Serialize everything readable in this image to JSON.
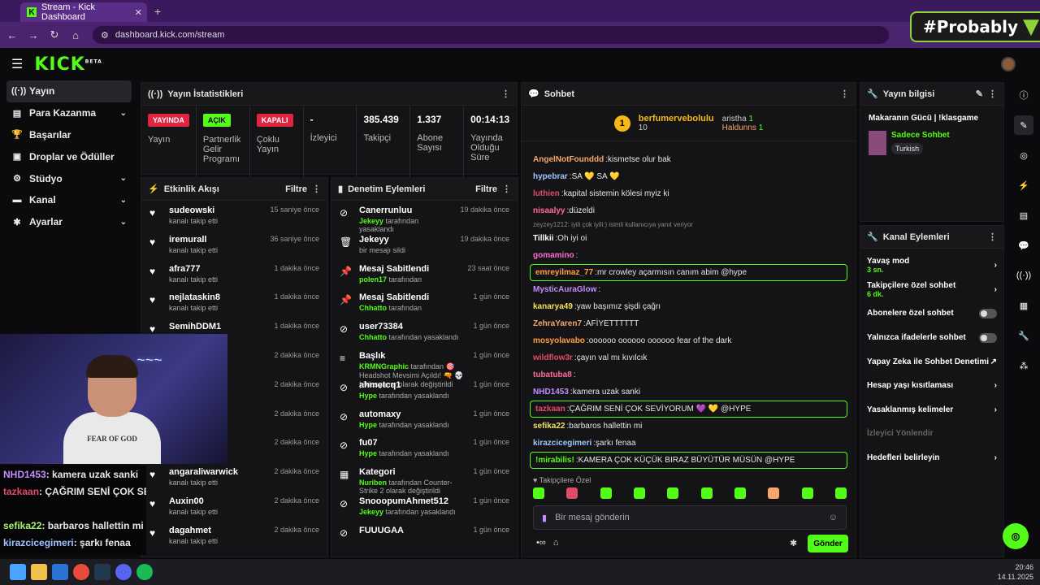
{
  "browser": {
    "tab_title": "Stream - Kick Dashboard",
    "url": "dashboard.kick.com/stream",
    "overlay_brand": "#Probably"
  },
  "colors": {
    "accent": "#53fc18",
    "live": "#e0243f"
  },
  "logo": "KICK",
  "logo_beta": "BETA",
  "sidebar": {
    "items": [
      {
        "label": "Yayın",
        "icon": "broadcast-icon",
        "active": true
      },
      {
        "label": "Para Kazanma",
        "icon": "money-icon",
        "expandable": true
      },
      {
        "label": "Başarılar",
        "icon": "trophy-icon"
      },
      {
        "label": "Droplar ve Ödüller",
        "icon": "gift-icon"
      },
      {
        "label": "Stüdyo",
        "icon": "studio-icon",
        "expandable": true
      },
      {
        "label": "Kanal",
        "icon": "channel-icon",
        "expandable": true
      },
      {
        "label": "Ayarlar",
        "icon": "gear-icon",
        "expandable": true
      }
    ]
  },
  "stats": {
    "title": "Yayın İstatistikleri",
    "cols": [
      {
        "badge": "YAYINDA",
        "label": "Yayın"
      },
      {
        "badge": "AÇIK",
        "label": "Partnerlik Gelir Programı"
      },
      {
        "badge": "KAPALI",
        "label": "Çoklu Yayın"
      },
      {
        "value": "-",
        "label": "İzleyici"
      },
      {
        "value": "385.439",
        "label": "Takipçi"
      },
      {
        "value": "1.337",
        "label": "Abone Sayısı"
      },
      {
        "value": "00:14:13",
        "label": "Yayında Olduğu Süre"
      }
    ]
  },
  "activity": {
    "title": "Etkinlik Akışı",
    "filter": "Filtre",
    "items": [
      {
        "name": "sudeowski",
        "sub": "kanalı takip etti",
        "time": "15 saniye önce"
      },
      {
        "name": "iremurall",
        "sub": "kanalı takip etti",
        "time": "36 saniye önce"
      },
      {
        "name": "afra777",
        "sub": "kanalı takip etti",
        "time": "1 dakika önce"
      },
      {
        "name": "nejlataskin8",
        "sub": "kanalı takip etti",
        "time": "1 dakika önce"
      },
      {
        "name": "SemihDDM1",
        "sub": "kanalı takip etti",
        "time": "1 dakika önce"
      },
      {
        "name": "",
        "sub": "",
        "time": "2 dakika önce"
      },
      {
        "name": "",
        "sub": "",
        "time": "2 dakika önce"
      },
      {
        "name": "",
        "sub": "",
        "time": "2 dakika önce"
      },
      {
        "name": "",
        "sub": "",
        "time": "2 dakika önce"
      },
      {
        "name": "angaraliwarwick",
        "sub": "kanalı takip etti",
        "time": "2 dakika önce"
      },
      {
        "name": "Auxin00",
        "sub": "kanalı takip etti",
        "time": "2 dakika önce"
      },
      {
        "name": "dagahmet",
        "sub": "kanalı takip etti",
        "time": "2 dakika önce"
      }
    ]
  },
  "moderation": {
    "title": "Denetim Eylemleri",
    "filter": "Filtre",
    "items": [
      {
        "name": "Canerrunluu",
        "mod": "Jekeyy",
        "sub": " tarafından yasaklandı",
        "time": "19 dakika önce",
        "icon": "ban-icon"
      },
      {
        "name": "Jekeyy",
        "mod": "",
        "sub": "bir mesajı sildi",
        "time": "19 dakika önce",
        "icon": "trash-icon"
      },
      {
        "name": "Mesaj Sabitlendi",
        "mod": "polen17",
        "sub": " tarafından",
        "time": "23 saat önce",
        "icon": "pin-icon"
      },
      {
        "name": "Mesaj Sabitlendi",
        "mod": "Chhatto",
        "sub": " tarafından",
        "time": "1 gün önce",
        "icon": "pin-icon"
      },
      {
        "name": "user73384",
        "mod": "Chhatto",
        "sub": " tarafından yasaklandı",
        "time": "1 gün önce",
        "icon": "ban-icon"
      },
      {
        "name": "Başlık",
        "mod": "KRMNGraphic",
        "sub": " tarafından 🎯 Headshot Mevsimi Açıldı! 🔫 💀 | !klasgame olarak değiştirildi",
        "time": "1 gün önce",
        "icon": "text-icon"
      },
      {
        "name": "ahmetcq1",
        "mod": "Hype",
        "sub": " tarafından yasaklandı",
        "time": "1 gün önce",
        "icon": "ban-icon"
      },
      {
        "name": "automaxy",
        "mod": "Hype",
        "sub": " tarafından yasaklandı",
        "time": "1 gün önce",
        "icon": "ban-icon"
      },
      {
        "name": "fu07",
        "mod": "Hype",
        "sub": " tarafından yasaklandı",
        "time": "1 gün önce",
        "icon": "ban-icon"
      },
      {
        "name": "Kategori",
        "mod": "Nuriben",
        "sub": " tarafından Counter-Strike 2 olarak değiştirildi",
        "time": "1 gün önce",
        "icon": "tag-icon"
      },
      {
        "name": "SnooopumAhmet512",
        "mod": "Jekeyy",
        "sub": " tarafından yasaklandı",
        "time": "1 gün önce",
        "icon": "ban-icon"
      },
      {
        "name": "FUUUGAA",
        "mod": "",
        "sub": "",
        "time": "1 gün önce",
        "icon": "ban-icon"
      }
    ]
  },
  "chat": {
    "title": "Sohbet",
    "gifters": [
      {
        "rank": "1",
        "name": "berfumervebolulu",
        "count": "10"
      },
      {
        "name": "aristha",
        "count": "1"
      },
      {
        "name": "Haldunns",
        "count": "1"
      }
    ],
    "messages": [
      {
        "user": "AngelNotFounddd",
        "color": "#f6a56b",
        "text": "kismetse olur bak"
      },
      {
        "user": "hypebrar",
        "color": "#9fc5ff",
        "text": "SA 💛 SA 💛"
      },
      {
        "user": "luthien",
        "color": "#e24a6a",
        "text": "kapital sistemin kölesi myiz ki"
      },
      {
        "user": "nisaalyy",
        "color": "#ff6b9a",
        "text": "düzeldi"
      },
      {
        "user": "Tillkii",
        "color": "#ffffff",
        "text": "Oh iyi oi",
        "reply": "zeyzey1212: iyili çok iyili:) isimli kullanıcıya yanıt veriyor"
      },
      {
        "user": "gomamino",
        "color": "#ff6bd0",
        "text": ""
      },
      {
        "user": "emreyilmaz_77",
        "color": "#ff9f43",
        "text": "mr crowley açarmısın canım abim @hype",
        "hl": true
      },
      {
        "user": "MysticAuraGlow",
        "color": "#c48dff",
        "text": ""
      },
      {
        "user": "kanarya49",
        "color": "#f6e05e",
        "text": "yaw başımız şişdi çağrı"
      },
      {
        "user": "ZehraYaren7",
        "color": "#f6a56b",
        "text": "AFİYETTTTTT"
      },
      {
        "user": "mosyolavabo",
        "color": "#ff9f43",
        "text": "oooooo oooooo oooooo fear of the dark"
      },
      {
        "user": "wildflow3r",
        "color": "#e24a6a",
        "text": "çayın val mı kıvılcık"
      },
      {
        "user": "tubatuba8",
        "color": "#ff6b9a",
        "text": ""
      },
      {
        "user": "NHD1453",
        "color": "#c48dff",
        "text": "kamera uzak sanki"
      },
      {
        "user": "tazkaan",
        "color": "#e24a6a",
        "text": "ÇAĞRIM SENİ ÇOK SEVİYORUM 💜 💛 @HYPE",
        "hl": true
      },
      {
        "user": "sefika22",
        "color": "#f6e05e",
        "text": "barbaros hallettin mi"
      },
      {
        "user": "kirazcicegimeri",
        "color": "#9fc5ff",
        "text": "şarkı fenaa"
      },
      {
        "user": "!mirabilis!",
        "color": "#53fc18",
        "text": "KAMERA ÇOK KÜÇÜK BIRAZ BÜYÜTÜR MÜSÜN @HYPE",
        "hl": true
      }
    ],
    "followers_only": "Takipçilere Özel",
    "placeholder": "Bir mesaj gönderin",
    "send": "Gönder"
  },
  "stream_info": {
    "title": "Yayın bilgisi",
    "stream_title": "Makaranın Gücü | !klasgame",
    "category": "Sadece Sohbet",
    "tag": "Turkish"
  },
  "channel_actions": {
    "title": "Kanal Eylemleri",
    "items": [
      {
        "label": "Yavaş mod",
        "sub": "3 sn.",
        "type": "chev"
      },
      {
        "label": "Takipçilere özel sohbet",
        "sub": "6 dk.",
        "type": "chev"
      },
      {
        "label": "Abonelere özel sohbet",
        "type": "toggle"
      },
      {
        "label": "Yalnızca ifadelerle sohbet",
        "type": "toggle"
      },
      {
        "label": "Yapay Zeka ile Sohbet Denetimi",
        "type": "ext"
      },
      {
        "label": "Hesap yaşı kısıtlaması",
        "type": "chev"
      },
      {
        "label": "Yasaklanmış kelimeler",
        "type": "chev"
      },
      {
        "label": "İzleyici Yönlendir",
        "type": "none",
        "disabled": true
      },
      {
        "label": "Hedefleri belirleyin",
        "type": "chev"
      }
    ]
  },
  "overlay_chat": [
    {
      "user": "NHD1453",
      "color": "#c48dff",
      "text": ": kamera uzak sanki"
    },
    {
      "user": "tazkaan",
      "color": "#e24a6a",
      "text": ": ÇAĞRIM SENİ ÇOK SEVİYORUM 💜 💛 @HYPE"
    },
    {
      "user": "",
      "color": "#e24a6a",
      "text": ""
    },
    {
      "user": "sefika22",
      "color": "#a6f36b",
      "text": ": barbaros hallettin mi"
    },
    {
      "user": "kirazcicegimeri",
      "color": "#9fc5ff",
      "text": ": şarkı fenaa"
    }
  ],
  "webcam": {
    "shirt": "FEAR OF GOD"
  },
  "taskbar": {
    "time": "20:46",
    "date": "14.11.2025"
  }
}
